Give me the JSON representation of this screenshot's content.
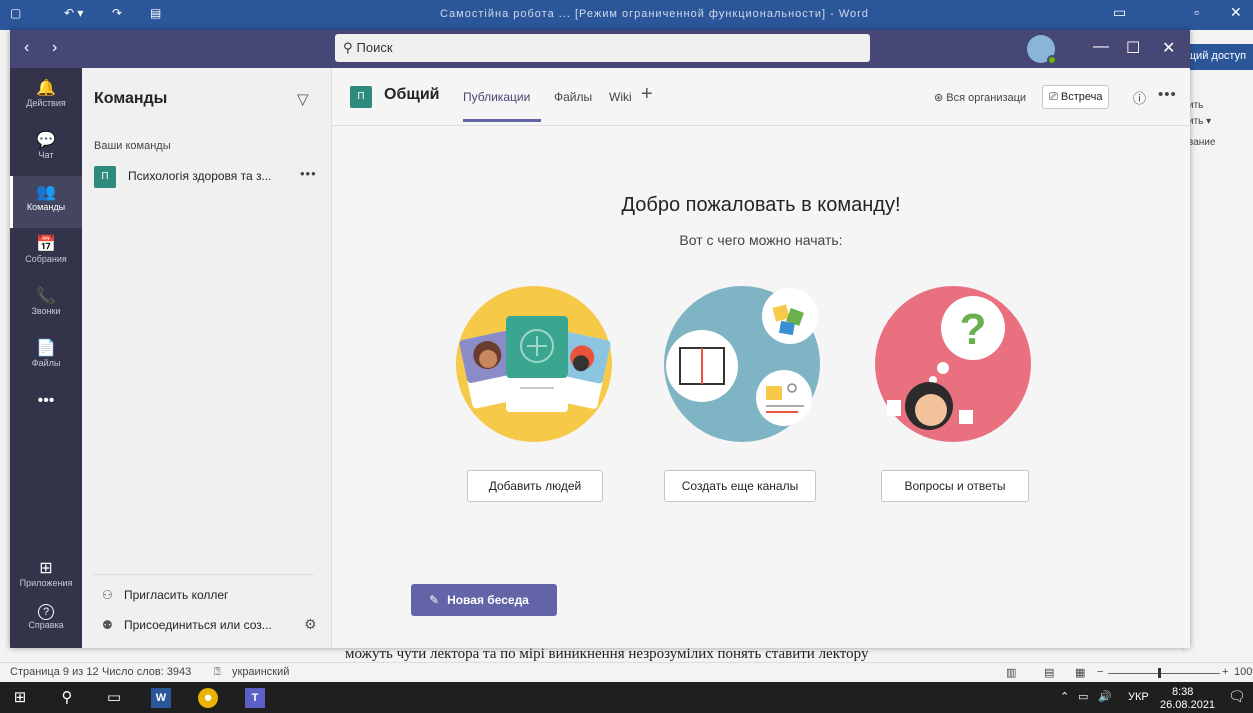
{
  "word": {
    "window_title": "Самостійна робота ... [Режим ограниченной функциональности] - Word",
    "share_label": "щий доступ",
    "ribbon_frags": [
      "ить",
      "ить ▾",
      "вание"
    ],
    "doc_text": "можуть чути лектора та по мірі виникнення незрозумілих понять ставити лектору",
    "status": {
      "page": "Страница 9 из 12",
      "words": "Число слов: 3943",
      "lang": "украинский",
      "zoom": "100%"
    }
  },
  "teams": {
    "search_placeholder": "Поиск",
    "rail": [
      {
        "label": "Действия",
        "icon": "bell-icon",
        "glyph": "🔔"
      },
      {
        "label": "Чат",
        "icon": "chat-icon",
        "glyph": "💬"
      },
      {
        "label": "Команды",
        "icon": "teams-icon",
        "glyph": "👥"
      },
      {
        "label": "Собрания",
        "icon": "calendar-icon",
        "glyph": "📅"
      },
      {
        "label": "Звонки",
        "icon": "phone-icon",
        "glyph": "📞"
      },
      {
        "label": "Файлы",
        "icon": "file-icon",
        "glyph": "📄"
      },
      {
        "label": "",
        "icon": "more-icon",
        "glyph": "•••"
      },
      {
        "label": "Приложения",
        "icon": "apps-icon",
        "glyph": "⊞"
      },
      {
        "label": "Справка",
        "icon": "help-icon",
        "glyph": "?"
      }
    ],
    "panel": {
      "title": "Команды",
      "section": "Ваши команды",
      "team": {
        "initial": "П",
        "name": "Психологія здоровя та з..."
      },
      "invite": "Пригласить коллег",
      "join": "Присоединиться или соз..."
    },
    "channel": {
      "initial": "П",
      "name": "Общий",
      "tabs": [
        "Публикации",
        "Файлы",
        "Wiki"
      ],
      "org": "Вся организаци",
      "meet": "Встреча"
    },
    "welcome": {
      "title": "Добро пожаловать в команду!",
      "subtitle": "Вот с чего можно начать:",
      "cards": [
        "Добавить людей",
        "Создать еще каналы",
        "Вопросы и ответы"
      ]
    },
    "new_chat": "Новая беседа"
  },
  "taskbar": {
    "lang": "УКР",
    "time": "8:38",
    "date": "26.08.2021"
  },
  "colors": {
    "word_blue": "#2b579a",
    "teams_purple": "#464775",
    "rail": "#33344a",
    "accent": "#6264a7"
  }
}
